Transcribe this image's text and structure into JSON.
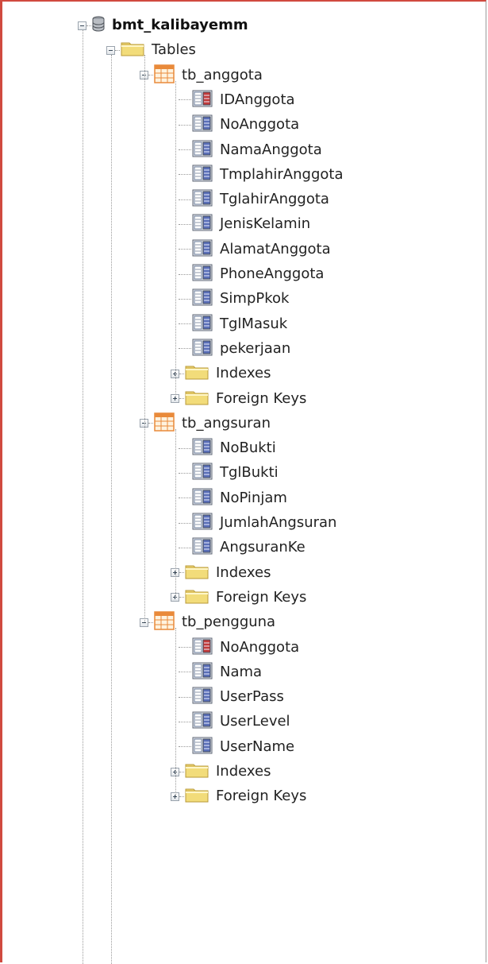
{
  "tree": {
    "database": "bmt_kalibayemm",
    "tables_label": "Tables",
    "tables": [
      {
        "name": "tb_anggota",
        "columns": [
          {
            "name": "IDAnggota",
            "key": true
          },
          {
            "name": "NoAnggota",
            "key": false
          },
          {
            "name": "NamaAnggota",
            "key": false
          },
          {
            "name": "TmplahirAnggota",
            "key": false
          },
          {
            "name": "TglahirAnggota",
            "key": false
          },
          {
            "name": "JenisKelamin",
            "key": false
          },
          {
            "name": "AlamatAnggota",
            "key": false
          },
          {
            "name": "PhoneAnggota",
            "key": false
          },
          {
            "name": "SimpPkok",
            "key": false
          },
          {
            "name": "TglMasuk",
            "key": false
          },
          {
            "name": "pekerjaan",
            "key": false
          }
        ],
        "indexes_label": "Indexes",
        "foreign_keys_label": "Foreign Keys"
      },
      {
        "name": "tb_angsuran",
        "columns": [
          {
            "name": "NoBukti",
            "key": false
          },
          {
            "name": "TglBukti",
            "key": false
          },
          {
            "name": "NoPinjam",
            "key": false
          },
          {
            "name": "JumlahAngsuran",
            "key": false
          },
          {
            "name": "AngsuranKe",
            "key": false
          }
        ],
        "indexes_label": "Indexes",
        "foreign_keys_label": "Foreign Keys"
      },
      {
        "name": "tb_pengguna",
        "columns": [
          {
            "name": "NoAnggota",
            "key": true
          },
          {
            "name": "Nama",
            "key": false
          },
          {
            "name": "UserPass",
            "key": false
          },
          {
            "name": "UserLevel",
            "key": false
          },
          {
            "name": "UserName",
            "key": false
          }
        ],
        "indexes_label": "Indexes",
        "foreign_keys_label": "Foreign Keys"
      }
    ]
  },
  "colors": {
    "frame_accent": "#d04a3f",
    "folder": "#f2dc7a",
    "table_grid": "#e98a3a",
    "column_blue": "#5a6fb8",
    "key_red": "#c23a3a"
  }
}
